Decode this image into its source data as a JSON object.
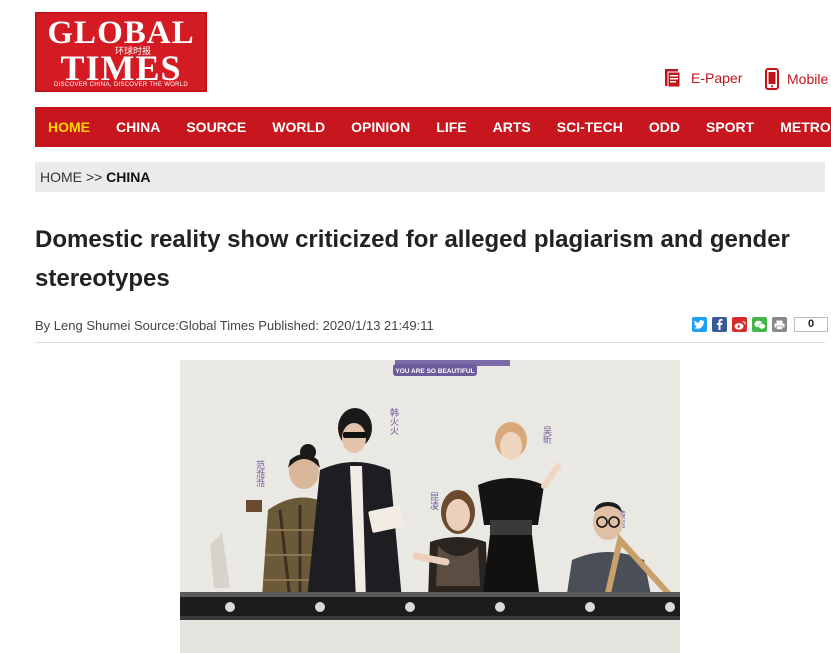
{
  "logo": {
    "line1": "GLOBAL",
    "line2": "TIMES",
    "chinese": "环球时报",
    "tagline": "DISCOVER CHINA, DISCOVER THE WORLD"
  },
  "header": {
    "epaper_label": "E-Paper",
    "mobile_label": "Mobile"
  },
  "nav": {
    "items": [
      "HOME",
      "CHINA",
      "SOURCE",
      "WORLD",
      "OPINION",
      "LIFE",
      "ARTS",
      "SCI-TECH",
      "ODD",
      "SPORT",
      "METRO"
    ],
    "active": "HOME"
  },
  "breadcrumb": {
    "home": "HOME",
    "separator": ">>",
    "current": "CHINA"
  },
  "article": {
    "title": "Domestic reality show criticized for alleged plagiarism and gender stereotypes",
    "byline": "By Leng Shumei Source:Global Times Published: 2020/1/13 21:49:11",
    "share_count": "0",
    "share_icons": [
      "twitter-icon",
      "facebook-icon",
      "weibo-icon",
      "wechat-icon",
      "print-icon"
    ],
    "share_colors": [
      "#1da1f2",
      "#3b5998",
      "#d52b2b",
      "#44b549",
      "#888888"
    ]
  },
  "photo": {
    "banner_text": "YOU ARE SO BEAUTIFUL",
    "name_labels": [
      "范湉湉",
      "韩火火",
      "昆凌",
      "吴昕",
      "黄吉"
    ]
  }
}
